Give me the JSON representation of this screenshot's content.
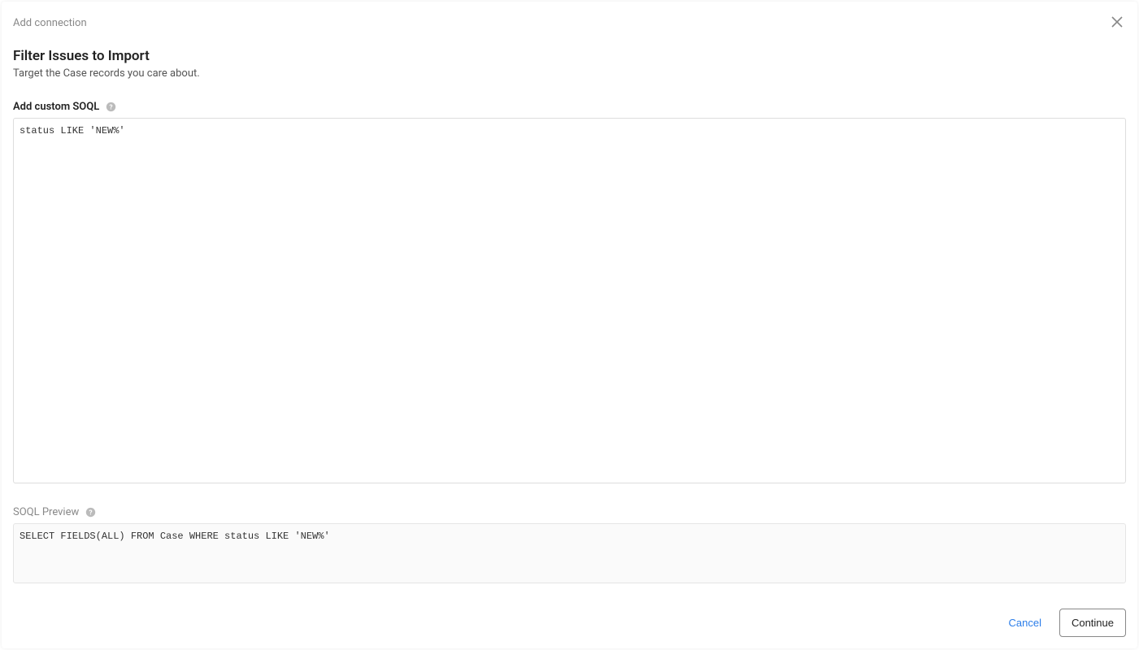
{
  "header": {
    "breadcrumb": "Add connection"
  },
  "main": {
    "title": "Filter Issues to Import",
    "subtitle": "Target the Case records you care about.",
    "soql_label": "Add custom SOQL",
    "soql_value": "status LIKE 'NEW%'",
    "preview_label": "SOQL Preview",
    "preview_value": "SELECT FIELDS(ALL) FROM Case WHERE status LIKE 'NEW%'"
  },
  "footer": {
    "cancel_label": "Cancel",
    "continue_label": "Continue"
  }
}
